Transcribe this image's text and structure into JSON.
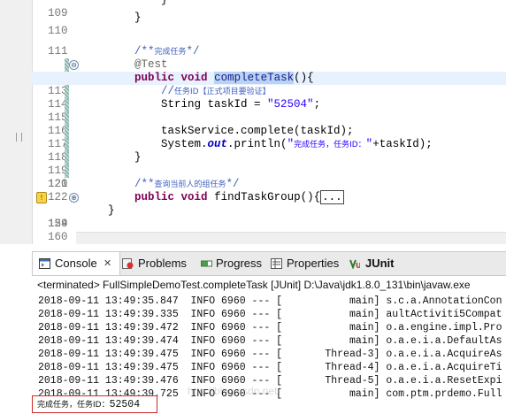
{
  "editor": {
    "lines": [
      {
        "num": "109",
        "indent": "        ",
        "text": "}"
      },
      {
        "num": "110",
        "indent": "    ",
        "text": "}"
      },
      {
        "num": "111",
        "text": ""
      },
      {
        "num": "112",
        "comment_zh_prefix": "/**",
        "comment_zh": "完成任务",
        "comment_zh_suffix": "*/"
      },
      {
        "num": "113",
        "annotation": "@Test"
      },
      {
        "num": "114",
        "kw1": "public",
        "kw2": "void",
        "method": "completeTask",
        "rest": "(){"
      },
      {
        "num": "115",
        "comment_prefix": "//",
        "comment_zh": "任务ID【正式项目要验证】"
      },
      {
        "num": "116",
        "type": "String",
        "var": " taskId = ",
        "str": "\"52504\"",
        "end": ";"
      },
      {
        "num": "117",
        "text": ""
      },
      {
        "num": "118",
        "text": "        taskService.complete(taskId);"
      },
      {
        "num": "119",
        "pre": "        System.",
        "field": "out",
        "mid": ".println(",
        "str_open": "\"",
        "str_zh": "完成任务，任务ID：",
        "str_close": "\"",
        "tail": "+taskId);"
      },
      {
        "num": "120",
        "indent": "    ",
        "text": "}"
      },
      {
        "num": "121",
        "text": ""
      },
      {
        "num": "122",
        "comment_zh_prefix": "/**",
        "comment_zh": "查询当前人的组任务",
        "comment_zh_suffix": "*/"
      },
      {
        "num": "124",
        "kw1": "public",
        "kw2": "void",
        "method": "findTaskGroup",
        "rest": "(){",
        "boxed": "..."
      },
      {
        "num": "159",
        "text": "}"
      },
      {
        "num": "160",
        "text": ""
      }
    ],
    "fold_minus": "⊖",
    "fold_plus": "⊕",
    "warn_icon": "!"
  },
  "console": {
    "tabs": [
      {
        "name": "Console",
        "icon": "console-icon"
      },
      {
        "name": "Problems",
        "icon": "problems-icon"
      },
      {
        "name": "Progress",
        "icon": "progress-icon"
      },
      {
        "name": "Properties",
        "icon": "properties-icon"
      },
      {
        "name": "JUnit",
        "icon": "junit-icon"
      }
    ],
    "close": "✕",
    "terminated": "<terminated> FullSimpleDemoTest.completeTask [JUnit] D:\\Java\\jdk1.8.0_131\\bin\\javaw.exe",
    "log": [
      "2018-09-11 13:49:35.847  INFO 6960 --- [           main] s.c.a.AnnotationCon",
      "2018-09-11 13:49:39.335  INFO 6960 --- [           main] aultActiviti5Compat",
      "2018-09-11 13:49:39.472  INFO 6960 --- [           main] o.a.engine.impl.Pro",
      "2018-09-11 13:49:39.474  INFO 6960 --- [           main] o.a.e.i.a.DefaultAs",
      "2018-09-11 13:49:39.475  INFO 6960 --- [       Thread-3] o.a.e.i.a.AcquireAs",
      "2018-09-11 13:49:39.475  INFO 6960 --- [       Thread-4] o.a.e.i.a.AcquireTi",
      "2018-09-11 13:49:39.476  INFO 6960 --- [       Thread-5] o.a.e.i.a.ResetExpi",
      "2018-09-11 13:49:39.725  INFO 6960 --- [           main] com.ptm.prdemo.Full"
    ],
    "output_zh": "完成任务，任务ID：",
    "output_id": "52504",
    "watermark": "http://blog.csdn.net/"
  },
  "colors": {
    "keyword": "#7f0055",
    "comment": "#3f5fbf",
    "string": "#2a00ff",
    "annotation": "#646464",
    "selection": "#b8d3f4",
    "output_box": "#cc2b2b"
  }
}
